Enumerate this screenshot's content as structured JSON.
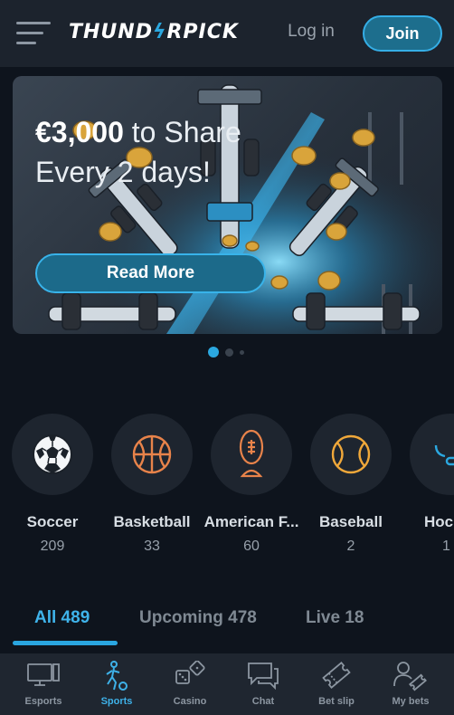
{
  "header": {
    "logo_left": "THUND",
    "logo_bolt": "ϟ",
    "logo_right": "RPICK",
    "login_label": "Log in",
    "join_label": "Join"
  },
  "banner": {
    "amount": "€3,000",
    "title_rest": " to Share",
    "title_line2": "Every 2 days!",
    "cta_label": "Read More",
    "slides": 3,
    "active_slide": 1
  },
  "sports": [
    {
      "name": "Soccer",
      "count": "209",
      "icon": "soccer-ball-icon"
    },
    {
      "name": "Basketball",
      "count": "33",
      "icon": "basketball-icon"
    },
    {
      "name": "American F...",
      "count": "60",
      "icon": "american-football-icon"
    },
    {
      "name": "Baseball",
      "count": "2",
      "icon": "baseball-icon"
    },
    {
      "name": "Hoc",
      "count": "1",
      "icon": "hockey-icon"
    }
  ],
  "tabs": [
    {
      "label": "All 489",
      "active": true
    },
    {
      "label": "Upcoming 478",
      "active": false
    },
    {
      "label": "Live 18",
      "active": false
    }
  ],
  "nav": [
    {
      "label": "Esports",
      "icon": "monitor-icon",
      "active": false
    },
    {
      "label": "Sports",
      "icon": "sports-player-icon",
      "active": true
    },
    {
      "label": "Casino",
      "icon": "dice-icon",
      "active": false
    },
    {
      "label": "Chat",
      "icon": "chat-icon",
      "active": false
    },
    {
      "label": "Bet slip",
      "icon": "ticket-icon",
      "active": false
    },
    {
      "label": "My bets",
      "icon": "user-ticket-icon",
      "active": false
    }
  ],
  "colors": {
    "accent": "#2ba8e0",
    "background": "#0e141d",
    "header": "#1c232d",
    "sport_icon_orange": "#e8834a",
    "sport_icon_yellow": "#f0a83a"
  }
}
